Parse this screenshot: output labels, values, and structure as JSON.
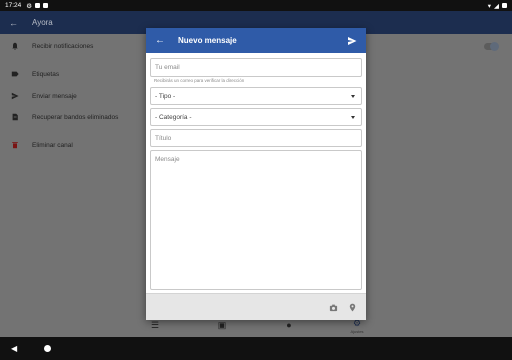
{
  "status_bar": {
    "time": "17:24"
  },
  "app_bar": {
    "title": "Ayora"
  },
  "settings": [
    {
      "label": "Recibir notificaciones",
      "icon": "bell-icon"
    },
    {
      "label": "Etiquetas",
      "icon": "label-icon"
    },
    {
      "label": "Enviar mensaje",
      "icon": "send-icon"
    },
    {
      "label": "Recuperar bandos eliminados",
      "icon": "restore-icon"
    },
    {
      "label": "Eliminar canal",
      "icon": "trash-icon"
    }
  ],
  "bottom_nav": {
    "settings_label": "Ajustes"
  },
  "dialog": {
    "title": "Nuevo mensaje",
    "email_placeholder": "Tu email",
    "email_hint": "Recibirás un correo para verificar la dirección",
    "tipo_value": "- Tipo -",
    "categoria_value": "- Categoría -",
    "titulo_placeholder": "Título",
    "mensaje_placeholder": "Mensaje"
  },
  "colors": {
    "dialog_header": "#2f5ba8",
    "app_bar": "#1c2d4f",
    "scrim": "#737373"
  }
}
